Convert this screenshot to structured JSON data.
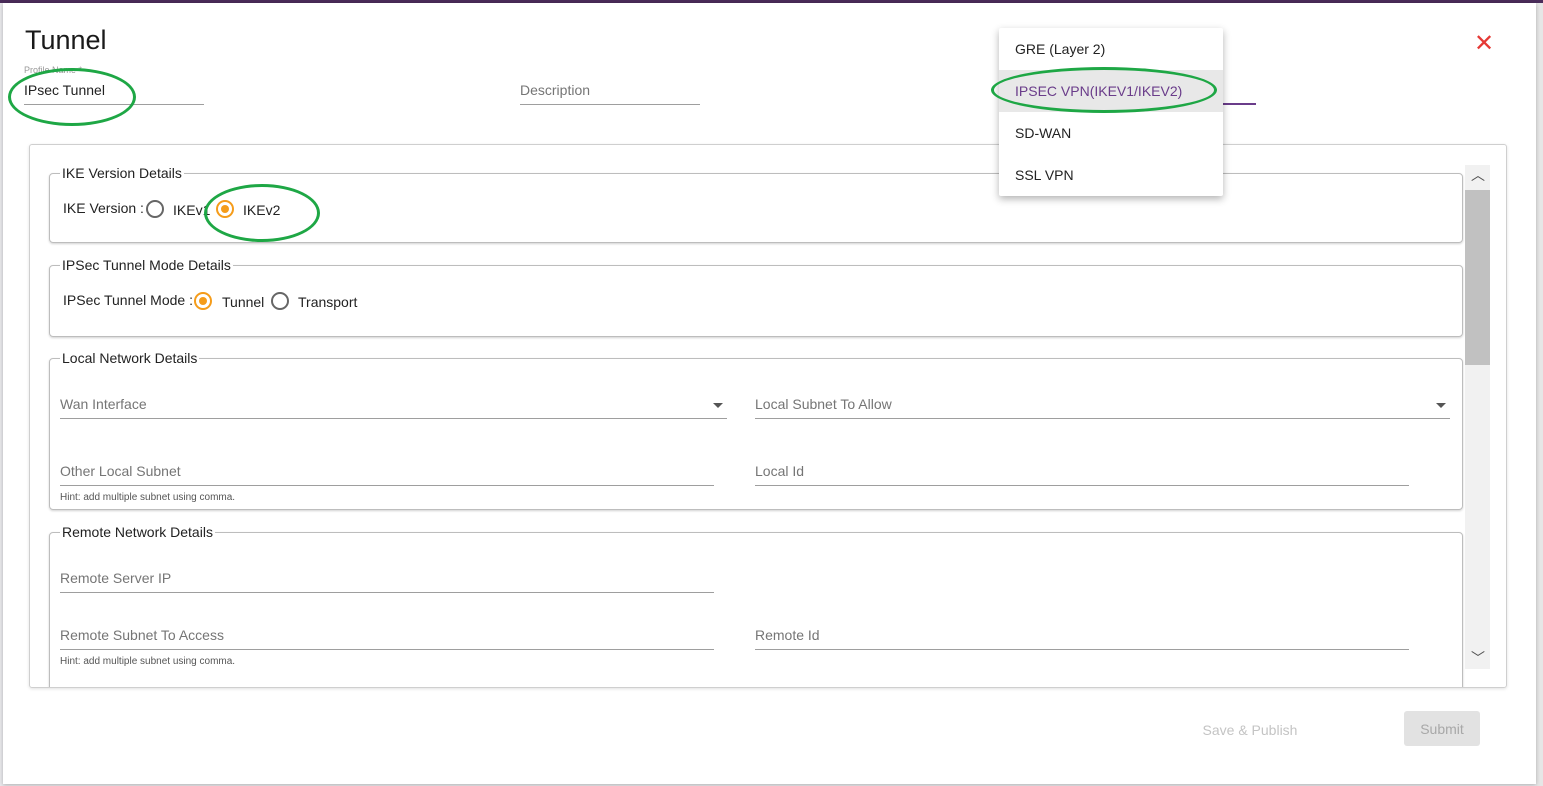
{
  "dialog": {
    "title": "Tunnel",
    "profile_name_label": "Profile Name *",
    "profile_name_value": "IPsec Tunnel",
    "description_placeholder": "Description"
  },
  "tunnel_type_menu": {
    "options": [
      "GRE (Layer 2)",
      "IPSEC VPN(IKEV1/IKEV2)",
      "SD-WAN",
      "SSL VPN"
    ],
    "selected": "IPSEC VPN(IKEV1/IKEV2)"
  },
  "ike_section": {
    "legend": "IKE Version Details",
    "label": "IKE Version :",
    "options": [
      "IKEv1",
      "IKEv2"
    ],
    "selected": "IKEv2"
  },
  "ipsec_mode_section": {
    "legend": "IPSec Tunnel Mode Details",
    "label": "IPSec Tunnel Mode :",
    "options": [
      "Tunnel",
      "Transport"
    ],
    "selected": "Tunnel"
  },
  "local_section": {
    "legend": "Local Network Details",
    "wan_interface": "Wan Interface",
    "local_subnet_allow": "Local Subnet To Allow",
    "other_local_subnet": "Other Local Subnet",
    "local_id": "Local Id",
    "hint": "Hint: add multiple subnet using comma."
  },
  "remote_section": {
    "legend": "Remote Network Details",
    "remote_server_ip": "Remote Server IP",
    "remote_subnet_access": "Remote Subnet To Access",
    "remote_id": "Remote Id",
    "hint": "Hint: add multiple subnet using comma."
  },
  "footer": {
    "save_publish": "Save & Publish",
    "submit": "Submit"
  },
  "colors": {
    "accent": "#f59c1a",
    "brand": "#6a3c8a",
    "close": "#e53935",
    "annotation": "#1ea745"
  }
}
